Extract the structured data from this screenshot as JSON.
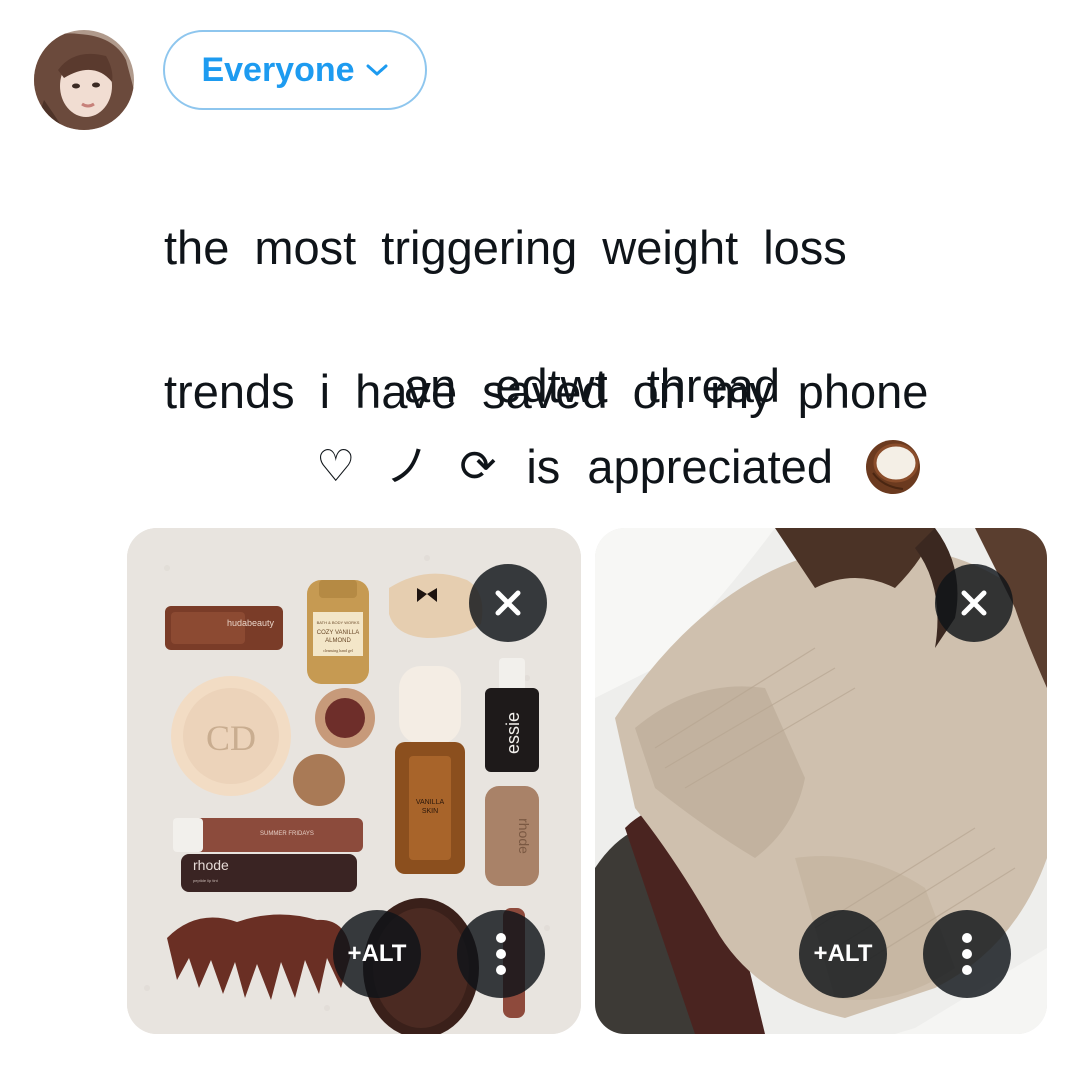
{
  "composer": {
    "audience_label": "Everyone",
    "avatar_icon": "user-avatar"
  },
  "tweet": {
    "text_lines": [
      "the most triggering weight loss",
      "trends i have saved on my phone"
    ],
    "thread_line": "an edtwt thread",
    "cta": {
      "heart_glyph": "♡",
      "slash_glyph": "ノ",
      "retweet_glyph": "⟳",
      "text": "is appreciated",
      "emoji_icon": "coconut-emoji"
    }
  },
  "media": [
    {
      "kind": "photo",
      "subject": "flatlay-beauty-products",
      "close_icon": "close-icon",
      "alt_label": "+ALT",
      "more_icon": "more-vertical-icon",
      "labels": {
        "huda": "hudabeauty",
        "sanitizer_brand": "BATH & BODY WORKS",
        "sanitizer_line1": "COZY VANILLA",
        "sanitizer_line2": "ALMOND",
        "sanitizer_sub": "cleansing hand gel",
        "dior": "CD",
        "essie": "essie",
        "rhode_tube": "rhode",
        "rhode_sub": "peptide lip tint",
        "rhode_can": "rhode",
        "summer_fridays": "SUMMER FRIDAYS",
        "vanilla_line1": "VANILLA",
        "vanilla_line2": "SKIN"
      }
    },
    {
      "kind": "photo",
      "subject": "beige-knit-sweater",
      "close_icon": "close-icon",
      "alt_label": "+ALT",
      "more_icon": "more-vertical-icon"
    }
  ],
  "colors": {
    "accent": "#1d9bf0",
    "accent_border": "#8ec6ee",
    "text": "#0f1419",
    "overlay": "#0f1419"
  }
}
